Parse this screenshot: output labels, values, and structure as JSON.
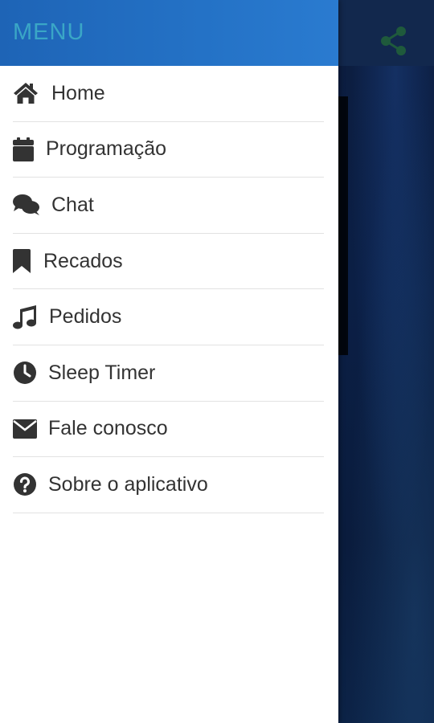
{
  "drawer": {
    "title": "MENU",
    "items": [
      {
        "label": "Home",
        "icon": "home-icon"
      },
      {
        "label": "Programação",
        "icon": "calendar-icon"
      },
      {
        "label": "Chat",
        "icon": "chat-icon"
      },
      {
        "label": "Recados",
        "icon": "bookmark-icon"
      },
      {
        "label": "Pedidos",
        "icon": "music-note-icon"
      },
      {
        "label": "Sleep Timer",
        "icon": "clock-icon"
      },
      {
        "label": "Fale conosco",
        "icon": "envelope-icon"
      },
      {
        "label": "Sobre o aplicativo",
        "icon": "question-circle-icon"
      }
    ]
  },
  "toolbar": {
    "share_icon": "share-icon"
  },
  "colors": {
    "header_blue": "#2472c6",
    "title_teal": "#3aa6c6",
    "icon_dark": "#333333",
    "share_green": "#1f5a3c",
    "background_navy": "#0b1f45"
  }
}
